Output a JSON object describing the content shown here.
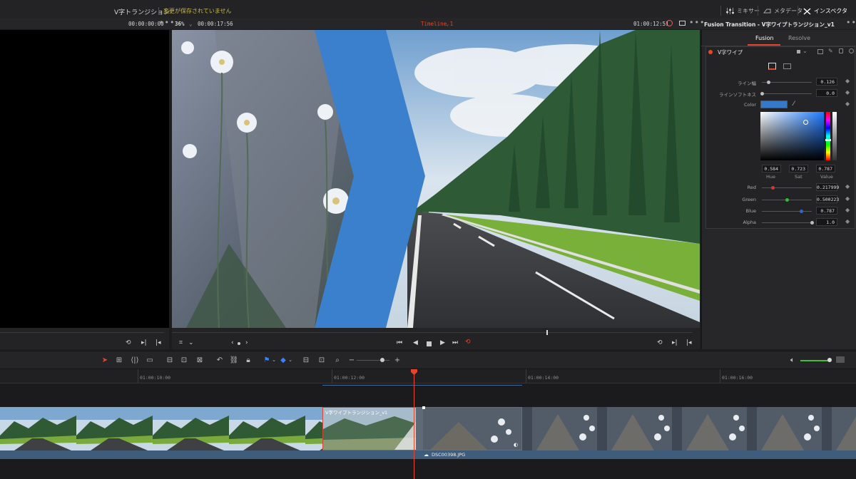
{
  "top": {
    "project_title": "V字トランジション",
    "unsaved": "変更が保存されていません",
    "mixer": "ミキサー",
    "metadata": "メタデータ",
    "inspector": "インスペクタ"
  },
  "viewer": {
    "source_tc": "00:00:00:00",
    "zoom": "36%",
    "duration_tc": "00:00:17:56",
    "timeline_name": "Timeline 1",
    "record_tc": "01:00:12:51",
    "more": "•••"
  },
  "inspector": {
    "title": "Fusion Transition - V字ワイプトランジション_v1",
    "tabs": [
      "Fusion",
      "Resolve"
    ],
    "active_tab": "Fusion",
    "node_name": "V字ワイプ",
    "params": {
      "line_width_label": "ライン幅",
      "line_width_value": "0.126",
      "line_width_fraction": 0.126,
      "softness_label": "ラインソフトネス",
      "softness_value": "0.0",
      "softness_fraction": 0.0,
      "color_label": "Color",
      "hue": "0.584",
      "sat": "0.723",
      "value": "0.787",
      "hue_label": "Hue",
      "sat_label": "Sat",
      "value_label": "Value",
      "red_label": "Red",
      "red_value": "0.217999",
      "red_fraction": 0.218,
      "green_label": "Green",
      "green_value": "0.500223",
      "green_fraction": 0.5,
      "blue_label": "Blue",
      "blue_value": "0.787",
      "blue_fraction": 0.787,
      "alpha_label": "Alpha",
      "alpha_value": "1.0",
      "alpha_fraction": 1.0
    },
    "swatch_color": "#3779c9"
  },
  "timeline": {
    "ruler": [
      "01:00:10:00",
      "01:00:12:00",
      "01:00:14:00",
      "01:00:16:00"
    ],
    "transition_label": "V字ワイプトランジション_v1",
    "audio_clip": "DSC00398.JPG"
  },
  "colors": {
    "accent_red": "#e8452c",
    "wipe_blue": "#3a80cc",
    "audio_blue": "#3f5c7a",
    "volume_green": "#3fbf3f"
  }
}
